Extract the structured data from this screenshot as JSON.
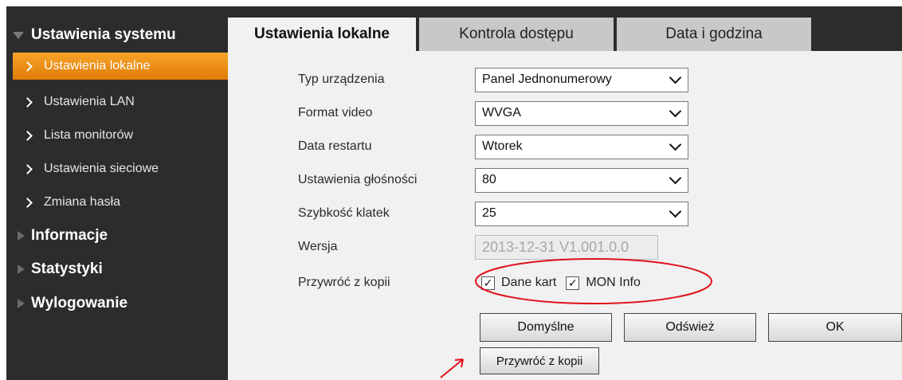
{
  "sidebar": {
    "section_title": "Ustawienia systemu",
    "sub_items": [
      {
        "label": "Ustawienia lokalne",
        "active": true
      },
      {
        "label": "Ustawienia LAN",
        "active": false
      },
      {
        "label": "Lista monitorów",
        "active": false
      },
      {
        "label": "Ustawienia sieciowe",
        "active": false
      },
      {
        "label": "Zmiana hasła",
        "active": false
      }
    ],
    "main_items": [
      {
        "label": "Informacje"
      },
      {
        "label": "Statystyki"
      },
      {
        "label": "Wylogowanie"
      }
    ]
  },
  "tabs": [
    {
      "label": "Ustawienia lokalne",
      "active": true
    },
    {
      "label": "Kontrola dostępu",
      "active": false
    },
    {
      "label": "Data i godzina",
      "active": false
    }
  ],
  "form": {
    "device_type": {
      "label": "Typ urządzenia",
      "value": "Panel Jednonumerowy"
    },
    "video_format": {
      "label": "Format video",
      "value": "WVGA"
    },
    "restart_date": {
      "label": "Data restartu",
      "value": "Wtorek"
    },
    "volume": {
      "label": "Ustawienia głośności",
      "value": "80"
    },
    "frame_rate": {
      "label": "Szybkość klatek",
      "value": "25"
    },
    "version": {
      "label": "Wersja",
      "value": "2013-12-31 V1.001.0.0"
    },
    "restore": {
      "label": "Przywróć z kopii",
      "options": [
        {
          "label": "Dane kart",
          "checked": true
        },
        {
          "label": "MON Info",
          "checked": true
        }
      ]
    }
  },
  "buttons": {
    "default_label": "Domyślne",
    "refresh_label": "Odśwież",
    "ok_label": "OK",
    "restore_label": "Przywróć z kopii"
  },
  "colors": {
    "sidebar_bg": "#2c2c2c",
    "active_item": "#f29111",
    "annotation": "#e0101a"
  }
}
